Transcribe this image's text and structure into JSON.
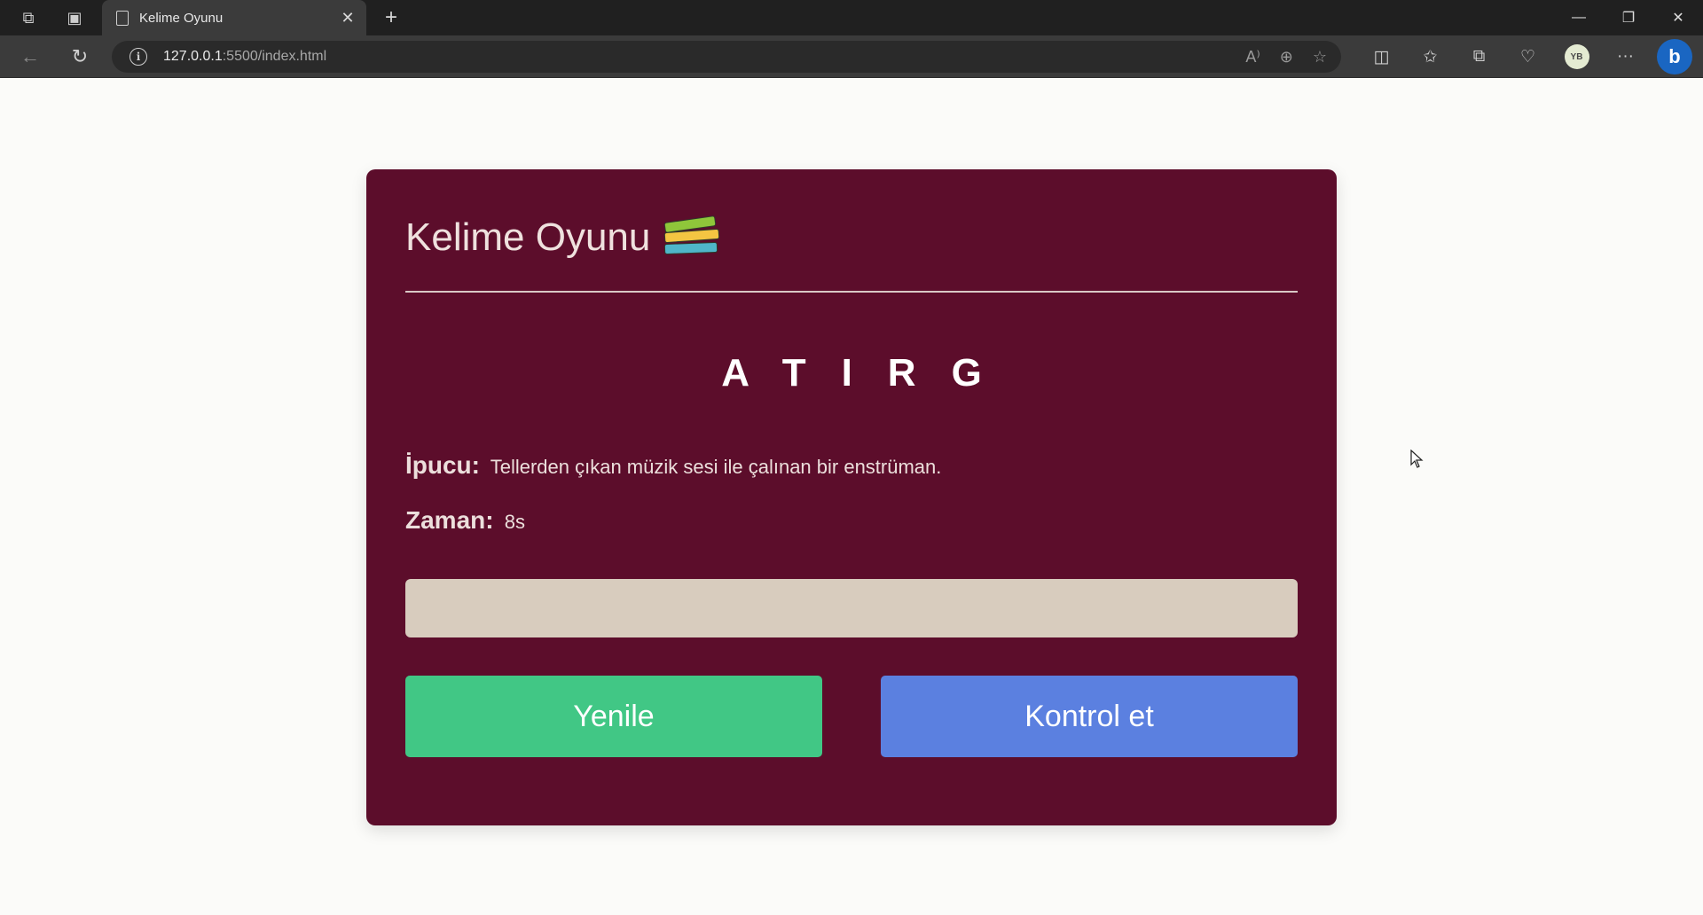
{
  "browser": {
    "tab_title": "Kelime Oyunu",
    "tab_close": "✕",
    "new_tab": "+",
    "url_host": "127.0.0.1",
    "url_path": ":5500/index.html",
    "avatar_initials": "YB",
    "more": "···",
    "bing_letter": "b"
  },
  "game": {
    "title": "Kelime Oyunu",
    "scrambled_word": "ATIRG",
    "hint_label": "İpucu:",
    "hint_text": "Tellerden çıkan müzik sesi ile çalınan bir enstrüman.",
    "time_label": "Zaman:",
    "time_value": "8s",
    "input_value": "",
    "refresh_label": "Yenile",
    "check_label": "Kontrol et"
  },
  "colors": {
    "card_bg": "#5c0d2b",
    "refresh_btn": "#41c785",
    "check_btn": "#5b80e0",
    "input_bg": "#d8ccbe"
  }
}
